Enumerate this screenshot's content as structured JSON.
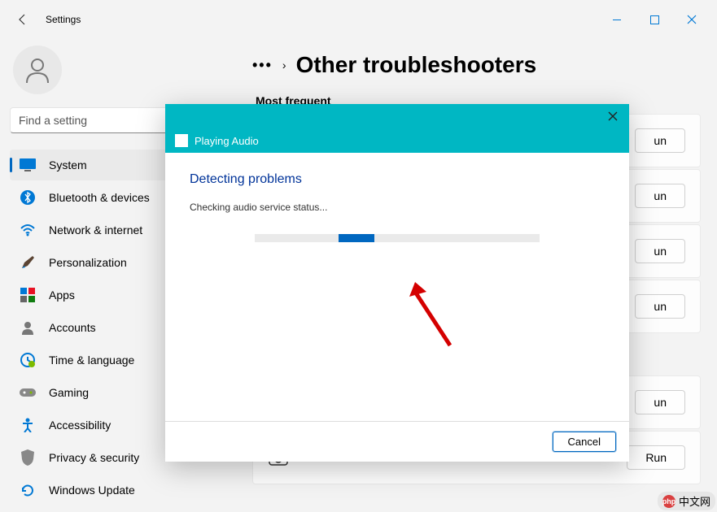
{
  "window": {
    "title": "Settings"
  },
  "search": {
    "placeholder": "Find a setting"
  },
  "nav": {
    "items": [
      {
        "label": "System",
        "active": true
      },
      {
        "label": "Bluetooth & devices"
      },
      {
        "label": "Network & internet"
      },
      {
        "label": "Personalization"
      },
      {
        "label": "Apps"
      },
      {
        "label": "Accounts"
      },
      {
        "label": "Time & language"
      },
      {
        "label": "Gaming"
      },
      {
        "label": "Accessibility"
      },
      {
        "label": "Privacy & security"
      },
      {
        "label": "Windows Update"
      }
    ]
  },
  "page": {
    "title": "Other troubleshooters",
    "section": "Most frequent",
    "run_label": "Run",
    "items": [
      {
        "label": "",
        "run": "un",
        "visible_label": ""
      },
      {
        "label": "",
        "run": "un"
      },
      {
        "label": "",
        "run": "un"
      },
      {
        "label": "",
        "run": "un"
      },
      {
        "label": "",
        "run": "un"
      },
      {
        "label": "Camera",
        "run": "Run"
      }
    ]
  },
  "dialog": {
    "app_title": "Playing Audio",
    "heading": "Detecting problems",
    "message": "Checking audio service status...",
    "cancel": "Cancel"
  },
  "watermark": {
    "text": "中文网",
    "prefix": "php"
  }
}
